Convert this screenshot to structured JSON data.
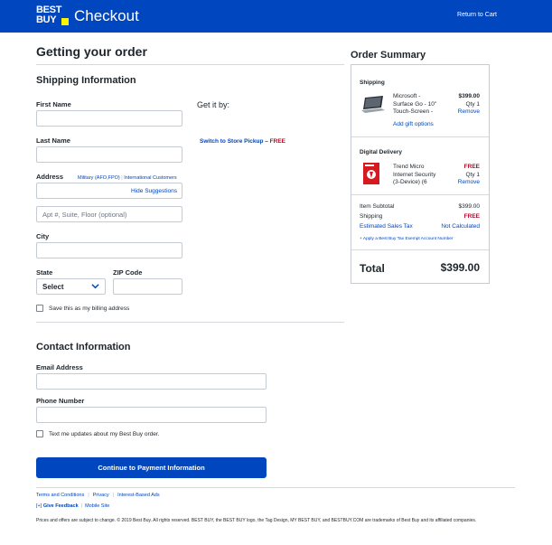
{
  "header": {
    "logo_line1": "BEST",
    "logo_line2": "BUY",
    "title": "Checkout",
    "return_to_cart": "Return to Cart",
    "brand_color": "#0046be",
    "logo_tag_color": "#fff200"
  },
  "main": {
    "heading": "Getting your order",
    "shipping": {
      "heading": "Shipping Information",
      "get_it_by": "Get it by:",
      "pickup_link": "Switch to Store Pickup",
      "pickup_dash": " – ",
      "pickup_free": "FREE",
      "first_name_label": "First Name",
      "first_name_value": "",
      "last_name_label": "Last Name",
      "last_name_value": "",
      "address_label": "Address",
      "military_link": "Military (AFO,FPO)",
      "address_sep": " | ",
      "international_link": "International Customers",
      "address_value": "",
      "hide_suggestions": "Hide Suggestions",
      "apt_placeholder": "Apt #, Suite, Floor (optional)",
      "city_label": "City",
      "city_value": "",
      "state_label": "State",
      "state_value": "Select",
      "zip_label": "ZIP Code",
      "zip_value": "",
      "billing_checkbox_label": "Save this as my billing address",
      "billing_checked": false
    },
    "contact": {
      "heading": "Contact Information",
      "email_label": "Email Address",
      "email_value": "",
      "phone_label": "Phone Number",
      "phone_value": "",
      "text_updates_label": "Text me updates about my Best Buy order.",
      "text_updates_checked": false
    },
    "continue_button": "Continue to Payment Information"
  },
  "order_summary": {
    "heading": "Order Summary",
    "shipping_section": "Shipping",
    "item1": {
      "name_line1": "Microsoft -",
      "name_line2": "Surface Go - 10\"",
      "name_line3": "Touch-Screen -",
      "price": "$399.00",
      "qty": "Qty 1",
      "remove": "Remove",
      "gift_options": "Add gift options"
    },
    "digital_section": "Digital Delivery",
    "item2": {
      "name_line1": "Trend Micro",
      "name_line2": "Internet Security",
      "name_line3": "(3-Device) (6",
      "price": "FREE",
      "qty": "Qty 1",
      "remove": "Remove"
    },
    "subtotal_label": "Item Subtotal",
    "subtotal_value": "$399.00",
    "shipping_label": "Shipping",
    "shipping_value": "FREE",
    "tax_label": "Estimated Sales Tax",
    "tax_value": "Not Calculated",
    "tax_exempt_link": "+ Apply a Best Buy Tax Exempt Account Number",
    "total_label": "Total",
    "total_value": "$399.00",
    "accent_red": "#bb0628"
  },
  "footer": {
    "terms": "Terms and Conditions",
    "privacy": "Privacy",
    "interest_ads": "Interest-Based Ads",
    "feedback_icon": "[+]",
    "feedback": "Give Feedback",
    "mobile_site": "Mobile Site",
    "legal": "Prices and offers are subject to change. © 2019 Best Buy. All rights reserved. BEST BUY, the BEST BUY logo, the Tag Design, MY BEST BUY, and BESTBUY.COM are trademarks of Best Buy and its affiliated companies."
  }
}
